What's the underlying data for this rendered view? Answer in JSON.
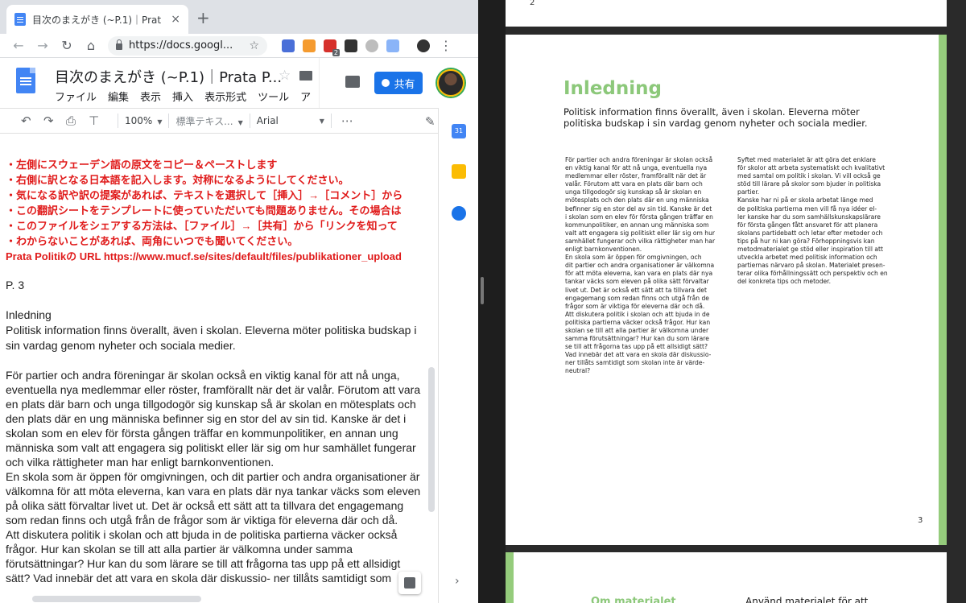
{
  "browser": {
    "tab_title": "目次のまえがき (~P.1)｜Prata Poli",
    "tab_close": "×",
    "new_tab": "+",
    "url": "https://docs.googl...",
    "ext_badge": "2"
  },
  "docs": {
    "title": "目次のまえがき (~P.1)｜Prata P...",
    "menu": [
      "ファイル",
      "編集",
      "表示",
      "挿入",
      "表示形式",
      "ツール",
      "ア"
    ],
    "share_label": "共有",
    "toolbar": {
      "zoom": "100%",
      "style": "標準テキス...",
      "font": "Arial"
    },
    "calendar_day": "31",
    "instructions": [
      "・左側にスウェーデン語の原文をコピー＆ペーストします",
      "・右側に訳となる日本語を記入します。対称になるようにしてください。",
      "・気になる訳や訳の提案があれば、テキストを選択して［挿入］→［コメント］から",
      "・この翻訳シートをテンプレートに使っていただいても問題ありません。その場合は",
      "・このファイルをシェアする方法は、［ファイル］→［共有］から「リンクを知って",
      "・わからないことがあれば、両角にいつでも聞いてください。",
      "Prata Politikの URL https://www.mucf.se/sites/default/files/publikationer_upload"
    ],
    "page_marker": "P. 3",
    "heading": "Inledning",
    "body": [
      "Politisk information finns överallt, även i skolan. Eleverna möter politiska budskap i",
      "sin vardag genom nyheter och sociala medier.",
      "",
      "För partier och andra föreningar är skolan också en viktig kanal för att nå unga,",
      "eventuella nya medlemmar eller röster, framförallt när det är valår. Förutom att vara",
      "en plats där barn och unga tillgodogör sig kunskap så är skolan en mötesplats och",
      "den plats där en ung människa befinner sig en stor del av sin tid. Kanske är det i",
      "skolan som en elev för första gången träffar en kommunpolitiker, en annan ung",
      "människa som valt att engagera sig politiskt eller lär sig om hur samhället fungerar",
      "och vilka rättigheter man har enligt barnkonventionen.",
      "En skola som är öppen för omgivningen, och dit partier och andra organisationer är",
      "välkomna för att möta eleverna, kan vara en plats där nya tankar väcks som eleven",
      "på olika sätt förvaltar livet ut. Det är också ett sätt att ta tillvara det engagemang",
      "som redan finns och utgå från de frågor som är viktiga för eleverna där och då.",
      "Att diskutera politik i skolan och att bjuda in de politiska partierna väcker också",
      "frågor. Hur kan skolan se till att alla partier är välkomna under samma",
      "förutsättningar? Hur kan du som lärare se till att frågorna tas upp på ett allsidigt",
      "sätt? Vad innebär det att vara en skola där diskussio- ner tillåts samtidigt som"
    ]
  },
  "pdf": {
    "prev_page_number": "2",
    "title": "Inledning",
    "intro": [
      "Politisk information finns överallt, även i skolan. Eleverna möter",
      "politiska budskap i sin vardag genom nyheter och sociala medier."
    ],
    "col1": [
      "För partier och andra föreningar är skolan också",
      "en viktig kanal för att nå unga, eventuella nya",
      "medlemmar eller röster, framförallt när det är",
      "valår. Förutom att vara en plats där barn och",
      "unga tillgodogör sig kunskap så är skolan en",
      "mötesplats och den plats där en ung människa",
      "befinner sig en stor del av sin tid. Kanske är det",
      "i skolan som en elev för första gången träffar en",
      "kommunpolitiker, en annan ung människa som",
      "valt att engagera sig politiskt eller lär sig om hur",
      "samhället fungerar och vilka rättigheter man har",
      "enligt barnkonventionen.",
      "  En skola som är öppen för omgivningen, och",
      "dit partier och andra organisationer är välkomna",
      "för att möta eleverna, kan vara en plats där nya",
      "tankar väcks som eleven på olika sätt förvaltar",
      "livet ut. Det är också ett sätt att ta tillvara det",
      "engagemang som redan finns och utgå från de",
      "frågor som är viktiga för eleverna där och då.",
      "  Att diskutera politik i skolan och att bjuda in de",
      "politiska partierna väcker också frågor. Hur kan",
      "skolan se till att alla partier är välkomna under",
      "samma förutsättningar? Hur kan du som lärare",
      "se till att frågorna tas upp på ett allsidigt sätt?",
      "Vad innebär det att vara en skola där diskussio-",
      "ner tillåts samtidigt som skolan inte är värde-",
      "neutral?"
    ],
    "col2": [
      "  Syftet med materialet är att göra det enklare",
      "för skolor att arbeta systematiskt och kvalitativt",
      "med samtal om politik i skolan. Vi vill också ge",
      "stöd till lärare på skolor som bjuder in politiska",
      "partier.",
      "  Kanske har ni på er skola arbetat länge med",
      "de politiska partierna men vill få nya idéer el-",
      "ler kanske har du som samhällskunskapslärare",
      "för första gången fått ansvaret för att planera",
      "skolans partidebatt och letar efter metoder och",
      "tips på hur ni kan göra? Förhoppningsvis kan",
      "metodmaterialet ge stöd eller inspiration till att",
      "utveckla arbetet med politisk information och",
      "partiernas närvaro på skolan. Materialet presen-",
      "terar olika förhållningssätt och perspektiv och en",
      "del konkreta tips och metoder."
    ],
    "page_number": "3",
    "next_heading_left": "Om materialet",
    "next_heading_right": "Använd materialet för att"
  }
}
